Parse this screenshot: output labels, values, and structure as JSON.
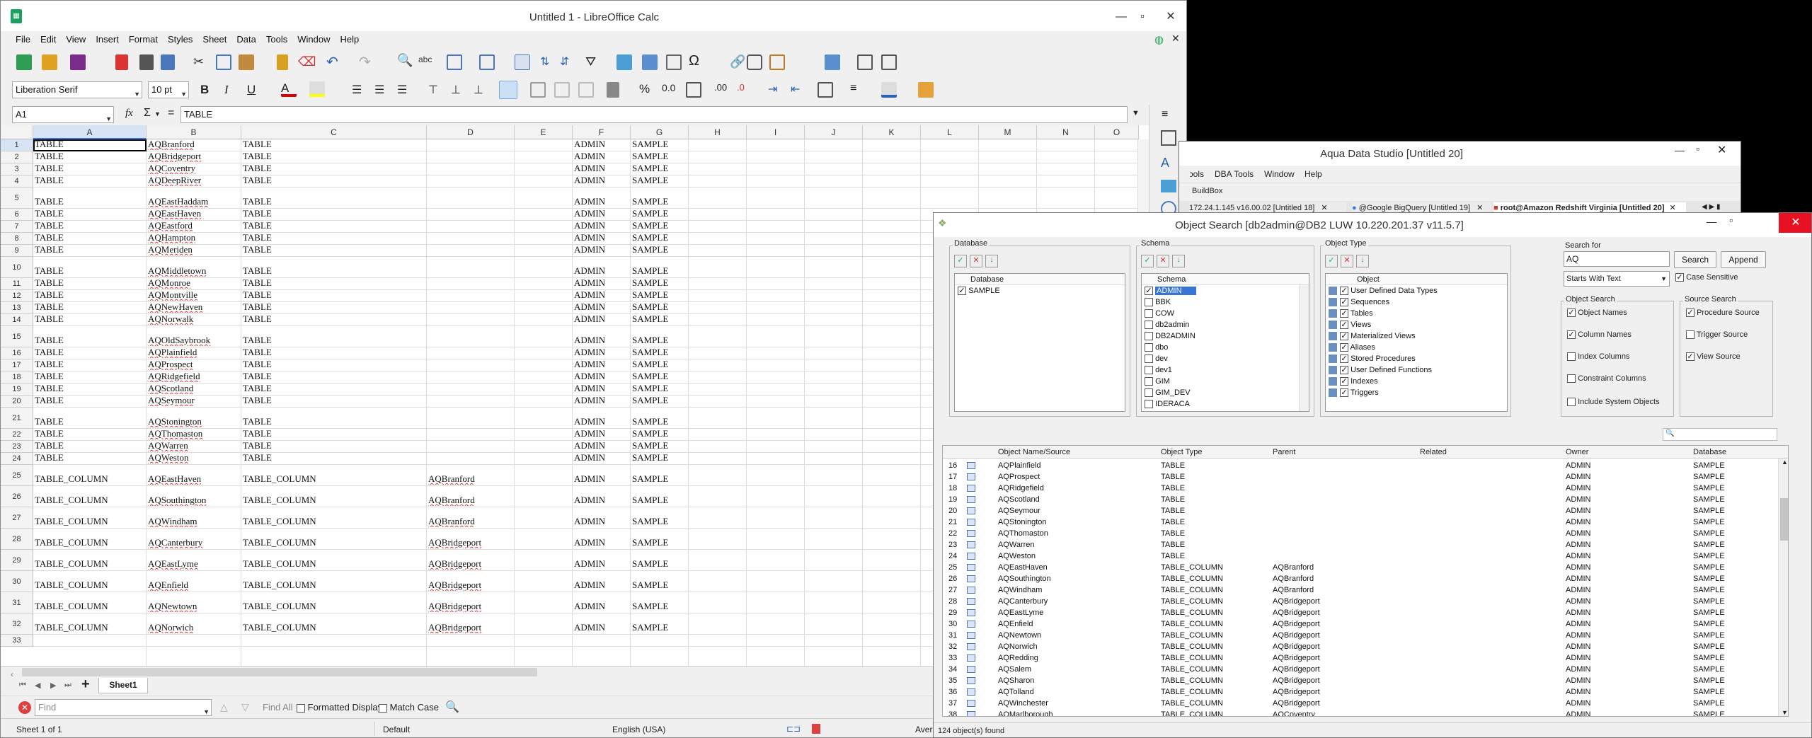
{
  "calc": {
    "title": "Untitled 1 - LibreOffice Calc",
    "menu": [
      "File",
      "Edit",
      "View",
      "Insert",
      "Format",
      "Styles",
      "Sheet",
      "Data",
      "Tools",
      "Window",
      "Help"
    ],
    "font_name": "Liberation Serif",
    "font_size": "10 pt",
    "name_box": "A1",
    "formula": "TABLE",
    "columns": [
      "A",
      "B",
      "C",
      "D",
      "E",
      "F",
      "G",
      "H",
      "I",
      "J",
      "K",
      "L",
      "M",
      "N",
      "O"
    ],
    "rows": [
      {
        "n": "1",
        "a": "TABLE",
        "b": "AQBranford",
        "c": "TABLE",
        "d": "",
        "f": "ADMIN",
        "g": "SAMPLE"
      },
      {
        "n": "2",
        "a": "TABLE",
        "b": "AQBridgeport",
        "c": "TABLE",
        "d": "",
        "f": "ADMIN",
        "g": "SAMPLE"
      },
      {
        "n": "3",
        "a": "TABLE",
        "b": "AQCoventry",
        "c": "TABLE",
        "d": "",
        "f": "ADMIN",
        "g": "SAMPLE"
      },
      {
        "n": "4",
        "a": "TABLE",
        "b": "AQDeepRiver",
        "c": "TABLE",
        "d": "",
        "f": "ADMIN",
        "g": "SAMPLE"
      },
      {
        "n": "5",
        "a": "TABLE",
        "b": "AQEastHaddam",
        "c": "TABLE",
        "d": "",
        "f": "ADMIN",
        "g": "SAMPLE"
      },
      {
        "n": "6",
        "a": "TABLE",
        "b": "AQEastHaven",
        "c": "TABLE",
        "d": "",
        "f": "ADMIN",
        "g": "SAMPLE"
      },
      {
        "n": "7",
        "a": "TABLE",
        "b": "AQEastford",
        "c": "TABLE",
        "d": "",
        "f": "ADMIN",
        "g": "SAMPLE"
      },
      {
        "n": "8",
        "a": "TABLE",
        "b": "AQHampton",
        "c": "TABLE",
        "d": "",
        "f": "ADMIN",
        "g": "SAMPLE"
      },
      {
        "n": "9",
        "a": "TABLE",
        "b": "AQMeriden",
        "c": "TABLE",
        "d": "",
        "f": "ADMIN",
        "g": "SAMPLE"
      },
      {
        "n": "10",
        "a": "TABLE",
        "b": "AQMiddletown",
        "c": "TABLE",
        "d": "",
        "f": "ADMIN",
        "g": "SAMPLE"
      },
      {
        "n": "11",
        "a": "TABLE",
        "b": "AQMonroe",
        "c": "TABLE",
        "d": "",
        "f": "ADMIN",
        "g": "SAMPLE"
      },
      {
        "n": "12",
        "a": "TABLE",
        "b": "AQMontville",
        "c": "TABLE",
        "d": "",
        "f": "ADMIN",
        "g": "SAMPLE"
      },
      {
        "n": "13",
        "a": "TABLE",
        "b": "AQNewHaven",
        "c": "TABLE",
        "d": "",
        "f": "ADMIN",
        "g": "SAMPLE"
      },
      {
        "n": "14",
        "a": "TABLE",
        "b": "AQNorwalk",
        "c": "TABLE",
        "d": "",
        "f": "ADMIN",
        "g": "SAMPLE"
      },
      {
        "n": "15",
        "a": "TABLE",
        "b": "AQOldSaybrook",
        "c": "TABLE",
        "d": "",
        "f": "ADMIN",
        "g": "SAMPLE"
      },
      {
        "n": "16",
        "a": "TABLE",
        "b": "AQPlainfield",
        "c": "TABLE",
        "d": "",
        "f": "ADMIN",
        "g": "SAMPLE"
      },
      {
        "n": "17",
        "a": "TABLE",
        "b": "AQProspect",
        "c": "TABLE",
        "d": "",
        "f": "ADMIN",
        "g": "SAMPLE"
      },
      {
        "n": "18",
        "a": "TABLE",
        "b": "AQRidgefield",
        "c": "TABLE",
        "d": "",
        "f": "ADMIN",
        "g": "SAMPLE"
      },
      {
        "n": "19",
        "a": "TABLE",
        "b": "AQScotland",
        "c": "TABLE",
        "d": "",
        "f": "ADMIN",
        "g": "SAMPLE"
      },
      {
        "n": "20",
        "a": "TABLE",
        "b": "AQSeymour",
        "c": "TABLE",
        "d": "",
        "f": "ADMIN",
        "g": "SAMPLE"
      },
      {
        "n": "21",
        "a": "TABLE",
        "b": "AQStonington",
        "c": "TABLE",
        "d": "",
        "f": "ADMIN",
        "g": "SAMPLE"
      },
      {
        "n": "22",
        "a": "TABLE",
        "b": "AQThomaston",
        "c": "TABLE",
        "d": "",
        "f": "ADMIN",
        "g": "SAMPLE"
      },
      {
        "n": "23",
        "a": "TABLE",
        "b": "AQWarren",
        "c": "TABLE",
        "d": "",
        "f": "ADMIN",
        "g": "SAMPLE"
      },
      {
        "n": "24",
        "a": "TABLE",
        "b": "AQWeston",
        "c": "TABLE",
        "d": "",
        "f": "ADMIN",
        "g": "SAMPLE"
      },
      {
        "n": "25",
        "a": "TABLE_COLUMN",
        "b": "AQEastHaven",
        "c": "TABLE_COLUMN",
        "d": "AQBranford",
        "f": "ADMIN",
        "g": "SAMPLE"
      },
      {
        "n": "26",
        "a": "TABLE_COLUMN",
        "b": "AQSouthington",
        "c": "TABLE_COLUMN",
        "d": "AQBranford",
        "f": "ADMIN",
        "g": "SAMPLE"
      },
      {
        "n": "27",
        "a": "TABLE_COLUMN",
        "b": "AQWindham",
        "c": "TABLE_COLUMN",
        "d": "AQBranford",
        "f": "ADMIN",
        "g": "SAMPLE"
      },
      {
        "n": "28",
        "a": "TABLE_COLUMN",
        "b": "AQCanterbury",
        "c": "TABLE_COLUMN",
        "d": "AQBridgeport",
        "f": "ADMIN",
        "g": "SAMPLE"
      },
      {
        "n": "29",
        "a": "TABLE_COLUMN",
        "b": "AQEastLyme",
        "c": "TABLE_COLUMN",
        "d": "AQBridgeport",
        "f": "ADMIN",
        "g": "SAMPLE"
      },
      {
        "n": "30",
        "a": "TABLE_COLUMN",
        "b": "AQEnfield",
        "c": "TABLE_COLUMN",
        "d": "AQBridgeport",
        "f": "ADMIN",
        "g": "SAMPLE"
      },
      {
        "n": "31",
        "a": "TABLE_COLUMN",
        "b": "AQNewtown",
        "c": "TABLE_COLUMN",
        "d": "AQBridgeport",
        "f": "ADMIN",
        "g": "SAMPLE"
      },
      {
        "n": "32",
        "a": "TABLE_COLUMN",
        "b": "AQNorwich",
        "c": "TABLE_COLUMN",
        "d": "AQBridgeport",
        "f": "ADMIN",
        "g": "SAMPLE"
      },
      {
        "n": "33",
        "a": "",
        "b": "",
        "c": "",
        "d": "",
        "f": "",
        "g": ""
      }
    ],
    "sheet_tab": "Sheet1",
    "find_placeholder": "Find",
    "find_all": "Find All",
    "formatted_display": "Formatted Display",
    "match_case": "Match Case",
    "status_sheet": "Sheet 1 of 1",
    "status_style": "Default",
    "status_lang": "English (USA)",
    "status_avg": "Aver"
  },
  "ads": {
    "title": "Aqua Data Studio [Untitled 20]",
    "menu": [
      "Tools",
      "DBA Tools",
      "Window",
      "Help"
    ],
    "toolbar_label": "BuildBox",
    "tabs": [
      "172.24.1.145 v16.00.02 [Untitled 18]",
      "@Google BigQuery [Untitled 19]",
      "root@Amazon Redshift Virginia [Untitled 20]"
    ]
  },
  "object_search": {
    "title": "Object Search [db2admin@DB2 LUW 10.220.201.37 v11.5.7]",
    "database_group": "Database",
    "database_header": "Database",
    "databases": [
      {
        "label": "SAMPLE",
        "checked": true
      }
    ],
    "schema_group": "Schema",
    "schema_header": "Schema",
    "schemas": [
      {
        "label": "ADMIN",
        "checked": true,
        "selected": true
      },
      {
        "label": "BBK",
        "checked": false
      },
      {
        "label": "COW",
        "checked": false
      },
      {
        "label": "db2admin",
        "checked": false
      },
      {
        "label": "DB2ADMIN",
        "checked": false
      },
      {
        "label": "dbo",
        "checked": false
      },
      {
        "label": "dev",
        "checked": false
      },
      {
        "label": "dev1",
        "checked": false
      },
      {
        "label": "GIM",
        "checked": false
      },
      {
        "label": "GIM_DEV",
        "checked": false
      },
      {
        "label": "IDERACA",
        "checked": false
      }
    ],
    "object_type_group": "Object Type",
    "object_header": "Object",
    "object_types": [
      {
        "label": "User Defined Data Types",
        "checked": true
      },
      {
        "label": "Sequences",
        "checked": true
      },
      {
        "label": "Tables",
        "checked": true
      },
      {
        "label": "Views",
        "checked": true
      },
      {
        "label": "Materialized Views",
        "checked": true
      },
      {
        "label": "Aliases",
        "checked": true
      },
      {
        "label": "Stored Procedures",
        "checked": true
      },
      {
        "label": "User Defined Functions",
        "checked": true
      },
      {
        "label": "Indexes",
        "checked": true
      },
      {
        "label": "Triggers",
        "checked": true
      }
    ],
    "search_for_label": "Search for",
    "search_value": "AQ",
    "search_button": "Search",
    "append_button": "Append",
    "match_mode": "Starts With Text",
    "case_sensitive": "Case Sensitive",
    "object_search_group": "Object Search",
    "object_search_opts": [
      {
        "label": "Object Names",
        "checked": true
      },
      {
        "label": "Column Names",
        "checked": true
      },
      {
        "label": "Index Columns",
        "checked": false
      },
      {
        "label": "Constraint Columns",
        "checked": false
      }
    ],
    "include_system": "Include System Objects",
    "source_search_group": "Source Search",
    "source_search_opts": [
      {
        "label": "Procedure Source",
        "checked": true
      },
      {
        "label": "Trigger Source",
        "checked": false
      },
      {
        "label": "View Source",
        "checked": true
      }
    ],
    "result_headers": [
      "Object Name/Source",
      "Object Type",
      "Parent",
      "Related",
      "Owner",
      "Database"
    ],
    "results": [
      {
        "n": "16",
        "name": "AQPlainfield",
        "type": "TABLE",
        "parent": "",
        "owner": "ADMIN",
        "db": "SAMPLE"
      },
      {
        "n": "17",
        "name": "AQProspect",
        "type": "TABLE",
        "parent": "",
        "owner": "ADMIN",
        "db": "SAMPLE"
      },
      {
        "n": "18",
        "name": "AQRidgefield",
        "type": "TABLE",
        "parent": "",
        "owner": "ADMIN",
        "db": "SAMPLE"
      },
      {
        "n": "19",
        "name": "AQScotland",
        "type": "TABLE",
        "parent": "",
        "owner": "ADMIN",
        "db": "SAMPLE"
      },
      {
        "n": "20",
        "name": "AQSeymour",
        "type": "TABLE",
        "parent": "",
        "owner": "ADMIN",
        "db": "SAMPLE"
      },
      {
        "n": "21",
        "name": "AQStonington",
        "type": "TABLE",
        "parent": "",
        "owner": "ADMIN",
        "db": "SAMPLE"
      },
      {
        "n": "22",
        "name": "AQThomaston",
        "type": "TABLE",
        "parent": "",
        "owner": "ADMIN",
        "db": "SAMPLE"
      },
      {
        "n": "23",
        "name": "AQWarren",
        "type": "TABLE",
        "parent": "",
        "owner": "ADMIN",
        "db": "SAMPLE"
      },
      {
        "n": "24",
        "name": "AQWeston",
        "type": "TABLE",
        "parent": "",
        "owner": "ADMIN",
        "db": "SAMPLE"
      },
      {
        "n": "25",
        "name": "AQEastHaven",
        "type": "TABLE_COLUMN",
        "parent": "AQBranford",
        "owner": "ADMIN",
        "db": "SAMPLE"
      },
      {
        "n": "26",
        "name": "AQSouthington",
        "type": "TABLE_COLUMN",
        "parent": "AQBranford",
        "owner": "ADMIN",
        "db": "SAMPLE"
      },
      {
        "n": "27",
        "name": "AQWindham",
        "type": "TABLE_COLUMN",
        "parent": "AQBranford",
        "owner": "ADMIN",
        "db": "SAMPLE"
      },
      {
        "n": "28",
        "name": "AQCanterbury",
        "type": "TABLE_COLUMN",
        "parent": "AQBridgeport",
        "owner": "ADMIN",
        "db": "SAMPLE"
      },
      {
        "n": "29",
        "name": "AQEastLyme",
        "type": "TABLE_COLUMN",
        "parent": "AQBridgeport",
        "owner": "ADMIN",
        "db": "SAMPLE"
      },
      {
        "n": "30",
        "name": "AQEnfield",
        "type": "TABLE_COLUMN",
        "parent": "AQBridgeport",
        "owner": "ADMIN",
        "db": "SAMPLE"
      },
      {
        "n": "31",
        "name": "AQNewtown",
        "type": "TABLE_COLUMN",
        "parent": "AQBridgeport",
        "owner": "ADMIN",
        "db": "SAMPLE"
      },
      {
        "n": "32",
        "name": "AQNorwich",
        "type": "TABLE_COLUMN",
        "parent": "AQBridgeport",
        "owner": "ADMIN",
        "db": "SAMPLE"
      },
      {
        "n": "33",
        "name": "AQRedding",
        "type": "TABLE_COLUMN",
        "parent": "AQBridgeport",
        "owner": "ADMIN",
        "db": "SAMPLE"
      },
      {
        "n": "34",
        "name": "AQSalem",
        "type": "TABLE_COLUMN",
        "parent": "AQBridgeport",
        "owner": "ADMIN",
        "db": "SAMPLE"
      },
      {
        "n": "35",
        "name": "AQSharon",
        "type": "TABLE_COLUMN",
        "parent": "AQBridgeport",
        "owner": "ADMIN",
        "db": "SAMPLE"
      },
      {
        "n": "36",
        "name": "AQTolland",
        "type": "TABLE_COLUMN",
        "parent": "AQBridgeport",
        "owner": "ADMIN",
        "db": "SAMPLE"
      },
      {
        "n": "37",
        "name": "AQWinchester",
        "type": "TABLE_COLUMN",
        "parent": "AQBridgeport",
        "owner": "ADMIN",
        "db": "SAMPLE"
      },
      {
        "n": "38",
        "name": "AQMarlborough",
        "type": "TABLE_COLUMN",
        "parent": "AQCoventry",
        "owner": "ADMIN",
        "db": "SAMPLE"
      }
    ],
    "status_count": "124 object(s) found"
  },
  "colors": {
    "selected_blue": "#3875d7",
    "accent_red": "#e04040",
    "close_red": "#e81123"
  }
}
